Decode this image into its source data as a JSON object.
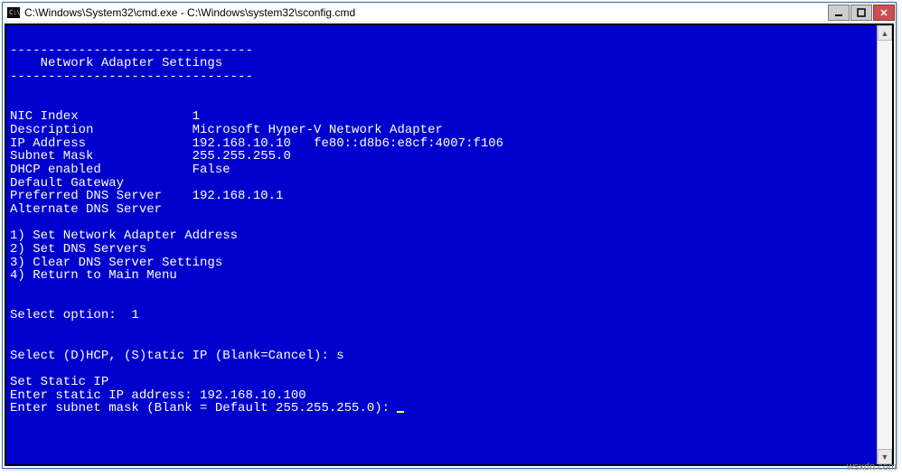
{
  "window": {
    "title": "C:\\Windows\\System32\\cmd.exe - C:\\Windows\\system32\\sconfig.cmd",
    "icon_name": "cmd-icon"
  },
  "heading": {
    "rule": "--------------------------------",
    "title": "    Network Adapter Settings"
  },
  "fields": {
    "nic_index": {
      "label": "NIC Index",
      "value": "1"
    },
    "description": {
      "label": "Description",
      "value": "Microsoft Hyper-V Network Adapter"
    },
    "ip_address": {
      "label": "IP Address",
      "value": "192.168.10.10   fe80::d8b6:e8cf:4007:f106"
    },
    "subnet_mask": {
      "label": "Subnet Mask",
      "value": "255.255.255.0"
    },
    "dhcp_enabled": {
      "label": "DHCP enabled",
      "value": "False"
    },
    "default_gateway": {
      "label": "Default Gateway",
      "value": ""
    },
    "preferred_dns": {
      "label": "Preferred DNS Server",
      "value": "192.168.10.1"
    },
    "alternate_dns": {
      "label": "Alternate DNS Server",
      "value": ""
    }
  },
  "menu": {
    "item1": "1) Set Network Adapter Address",
    "item2": "2) Set DNS Servers",
    "item3": "3) Clear DNS Server Settings",
    "item4": "4) Return to Main Menu"
  },
  "prompts": {
    "select_option_label": "Select option:  ",
    "select_option_value": "1",
    "select_mode_label": "Select (D)HCP, (S)tatic IP (Blank=Cancel): ",
    "select_mode_value": "s",
    "set_static_heading": "Set Static IP",
    "enter_static_ip_label": "Enter static IP address: ",
    "enter_static_ip_value": "192.168.10.100",
    "enter_subnet_label": "Enter subnet mask (Blank = Default 255.255.255.0): "
  },
  "watermark": "wsxdn.com"
}
